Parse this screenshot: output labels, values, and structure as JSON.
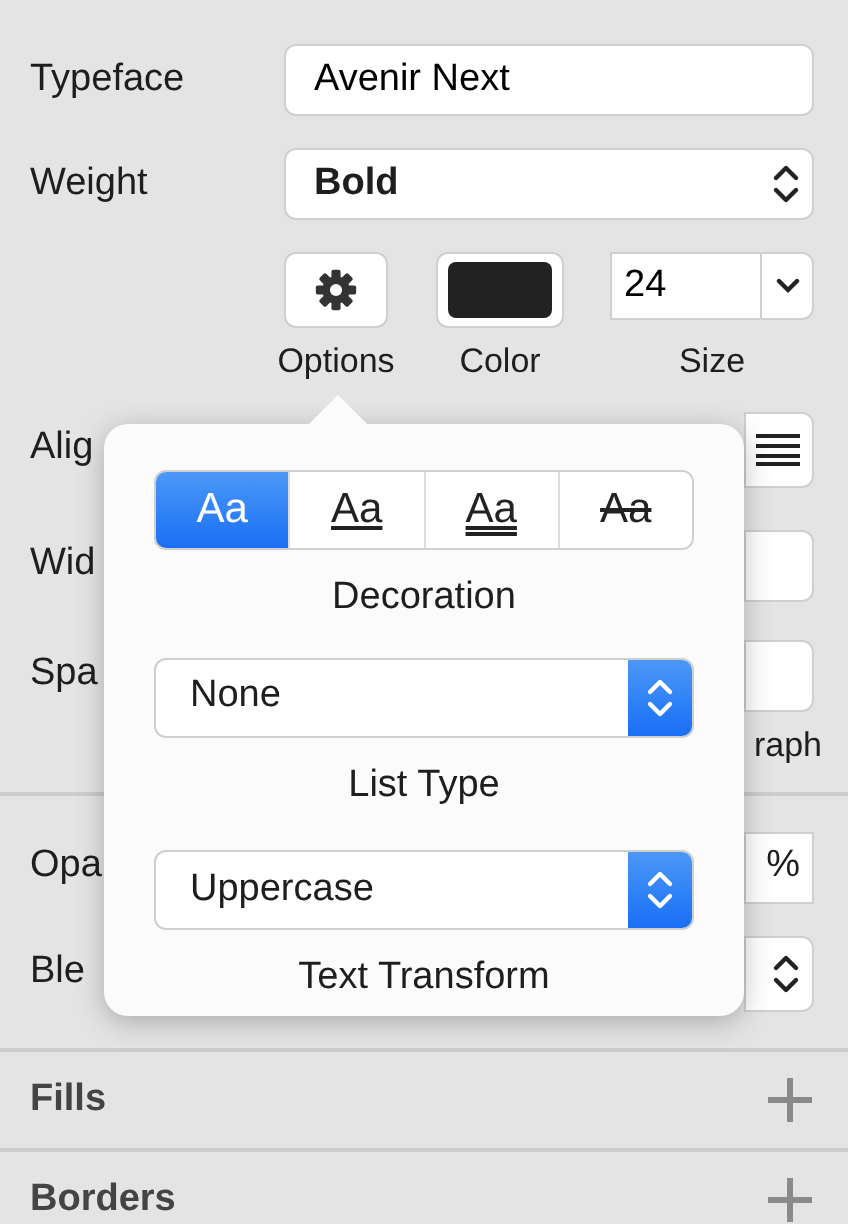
{
  "properties": [
    {
      "label": "Typeface",
      "kind": "text",
      "value": "Avenir Next"
    },
    {
      "label": "Weight",
      "kind": "select",
      "value": "Bold"
    }
  ],
  "text_controls": {
    "options_label": "Options",
    "color_label": "Color",
    "color": "#222222",
    "size_value": "24",
    "size_label": "Size"
  },
  "covered_rows": [
    {
      "label": "Alig",
      "kind": "alignment"
    },
    {
      "label": "Wid",
      "kind": "blank"
    },
    {
      "label": "Spa",
      "kind": "blank",
      "caption": "raph"
    },
    {
      "label": "Opa",
      "kind": "value",
      "value": "%"
    },
    {
      "label": "Ble",
      "kind": "select"
    }
  ],
  "sections": [
    {
      "title": "Fills"
    },
    {
      "title": "Borders"
    }
  ],
  "popover": {
    "decorations": [
      {
        "label": "Aa",
        "kind": "none",
        "selected": true
      },
      {
        "label": "Aa",
        "kind": "underline",
        "selected": false
      },
      {
        "label": "Aa",
        "kind": "double",
        "selected": false
      },
      {
        "label": "Aa",
        "kind": "strike",
        "selected": false
      }
    ],
    "decoration_caption": "Decoration",
    "list_type": "None",
    "list_type_caption": "List Type",
    "text_transform": "Uppercase",
    "text_transform_caption": "Text Transform"
  }
}
